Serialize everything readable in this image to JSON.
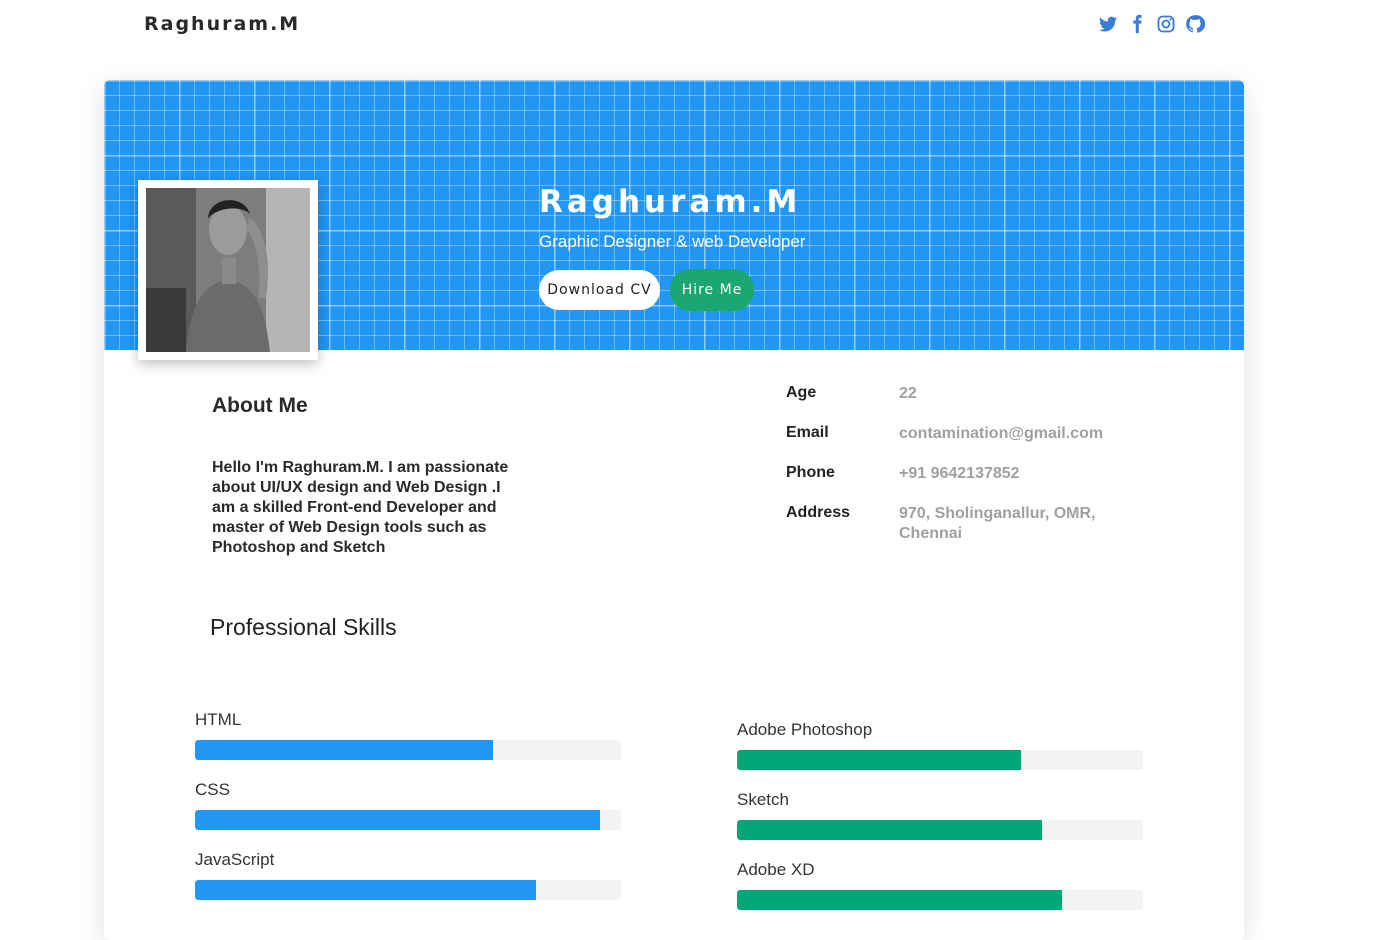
{
  "header": {
    "brand": "Raghuram.M",
    "social_icons": [
      "twitter-icon",
      "facebook-icon",
      "instagram-icon",
      "github-icon"
    ],
    "icon_color": "#3a7bd5"
  },
  "hero": {
    "name": "Raghuram.M",
    "title": "Graphic Designer & web Developer",
    "download_label": "Download CV",
    "hire_label": "Hire Me",
    "background_color": "#2196f3",
    "hire_color": "#1ba672"
  },
  "about": {
    "heading": "About Me",
    "text": "Hello I'm Raghuram.M. I am passionate about UI/UX design and Web Design .I am a skilled Front-end Developer and master of Web Design tools such as Photoshop and Sketch"
  },
  "info": [
    {
      "label": "Age",
      "value": "22"
    },
    {
      "label": "Email",
      "value": "contamination@gmail.com"
    },
    {
      "label": "Phone",
      "value": "+91 9642137852"
    },
    {
      "label": "Address",
      "value": "970, Sholinganallur, OMR, Chennai"
    }
  ],
  "skills": {
    "heading": "Professional Skills",
    "left": [
      {
        "name": "HTML",
        "level": 0.7,
        "color": "#2196f3"
      },
      {
        "name": "CSS",
        "level": 0.95,
        "color": "#2196f3"
      },
      {
        "name": "JavaScript",
        "level": 0.8,
        "color": "#2196f3"
      }
    ],
    "right": [
      {
        "name": "Adobe Photoshop",
        "level": 0.7,
        "color": "#00a676"
      },
      {
        "name": "Sketch",
        "level": 0.75,
        "color": "#00a676"
      },
      {
        "name": "Adobe XD",
        "level": 0.8,
        "color": "#00a676"
      }
    ]
  }
}
